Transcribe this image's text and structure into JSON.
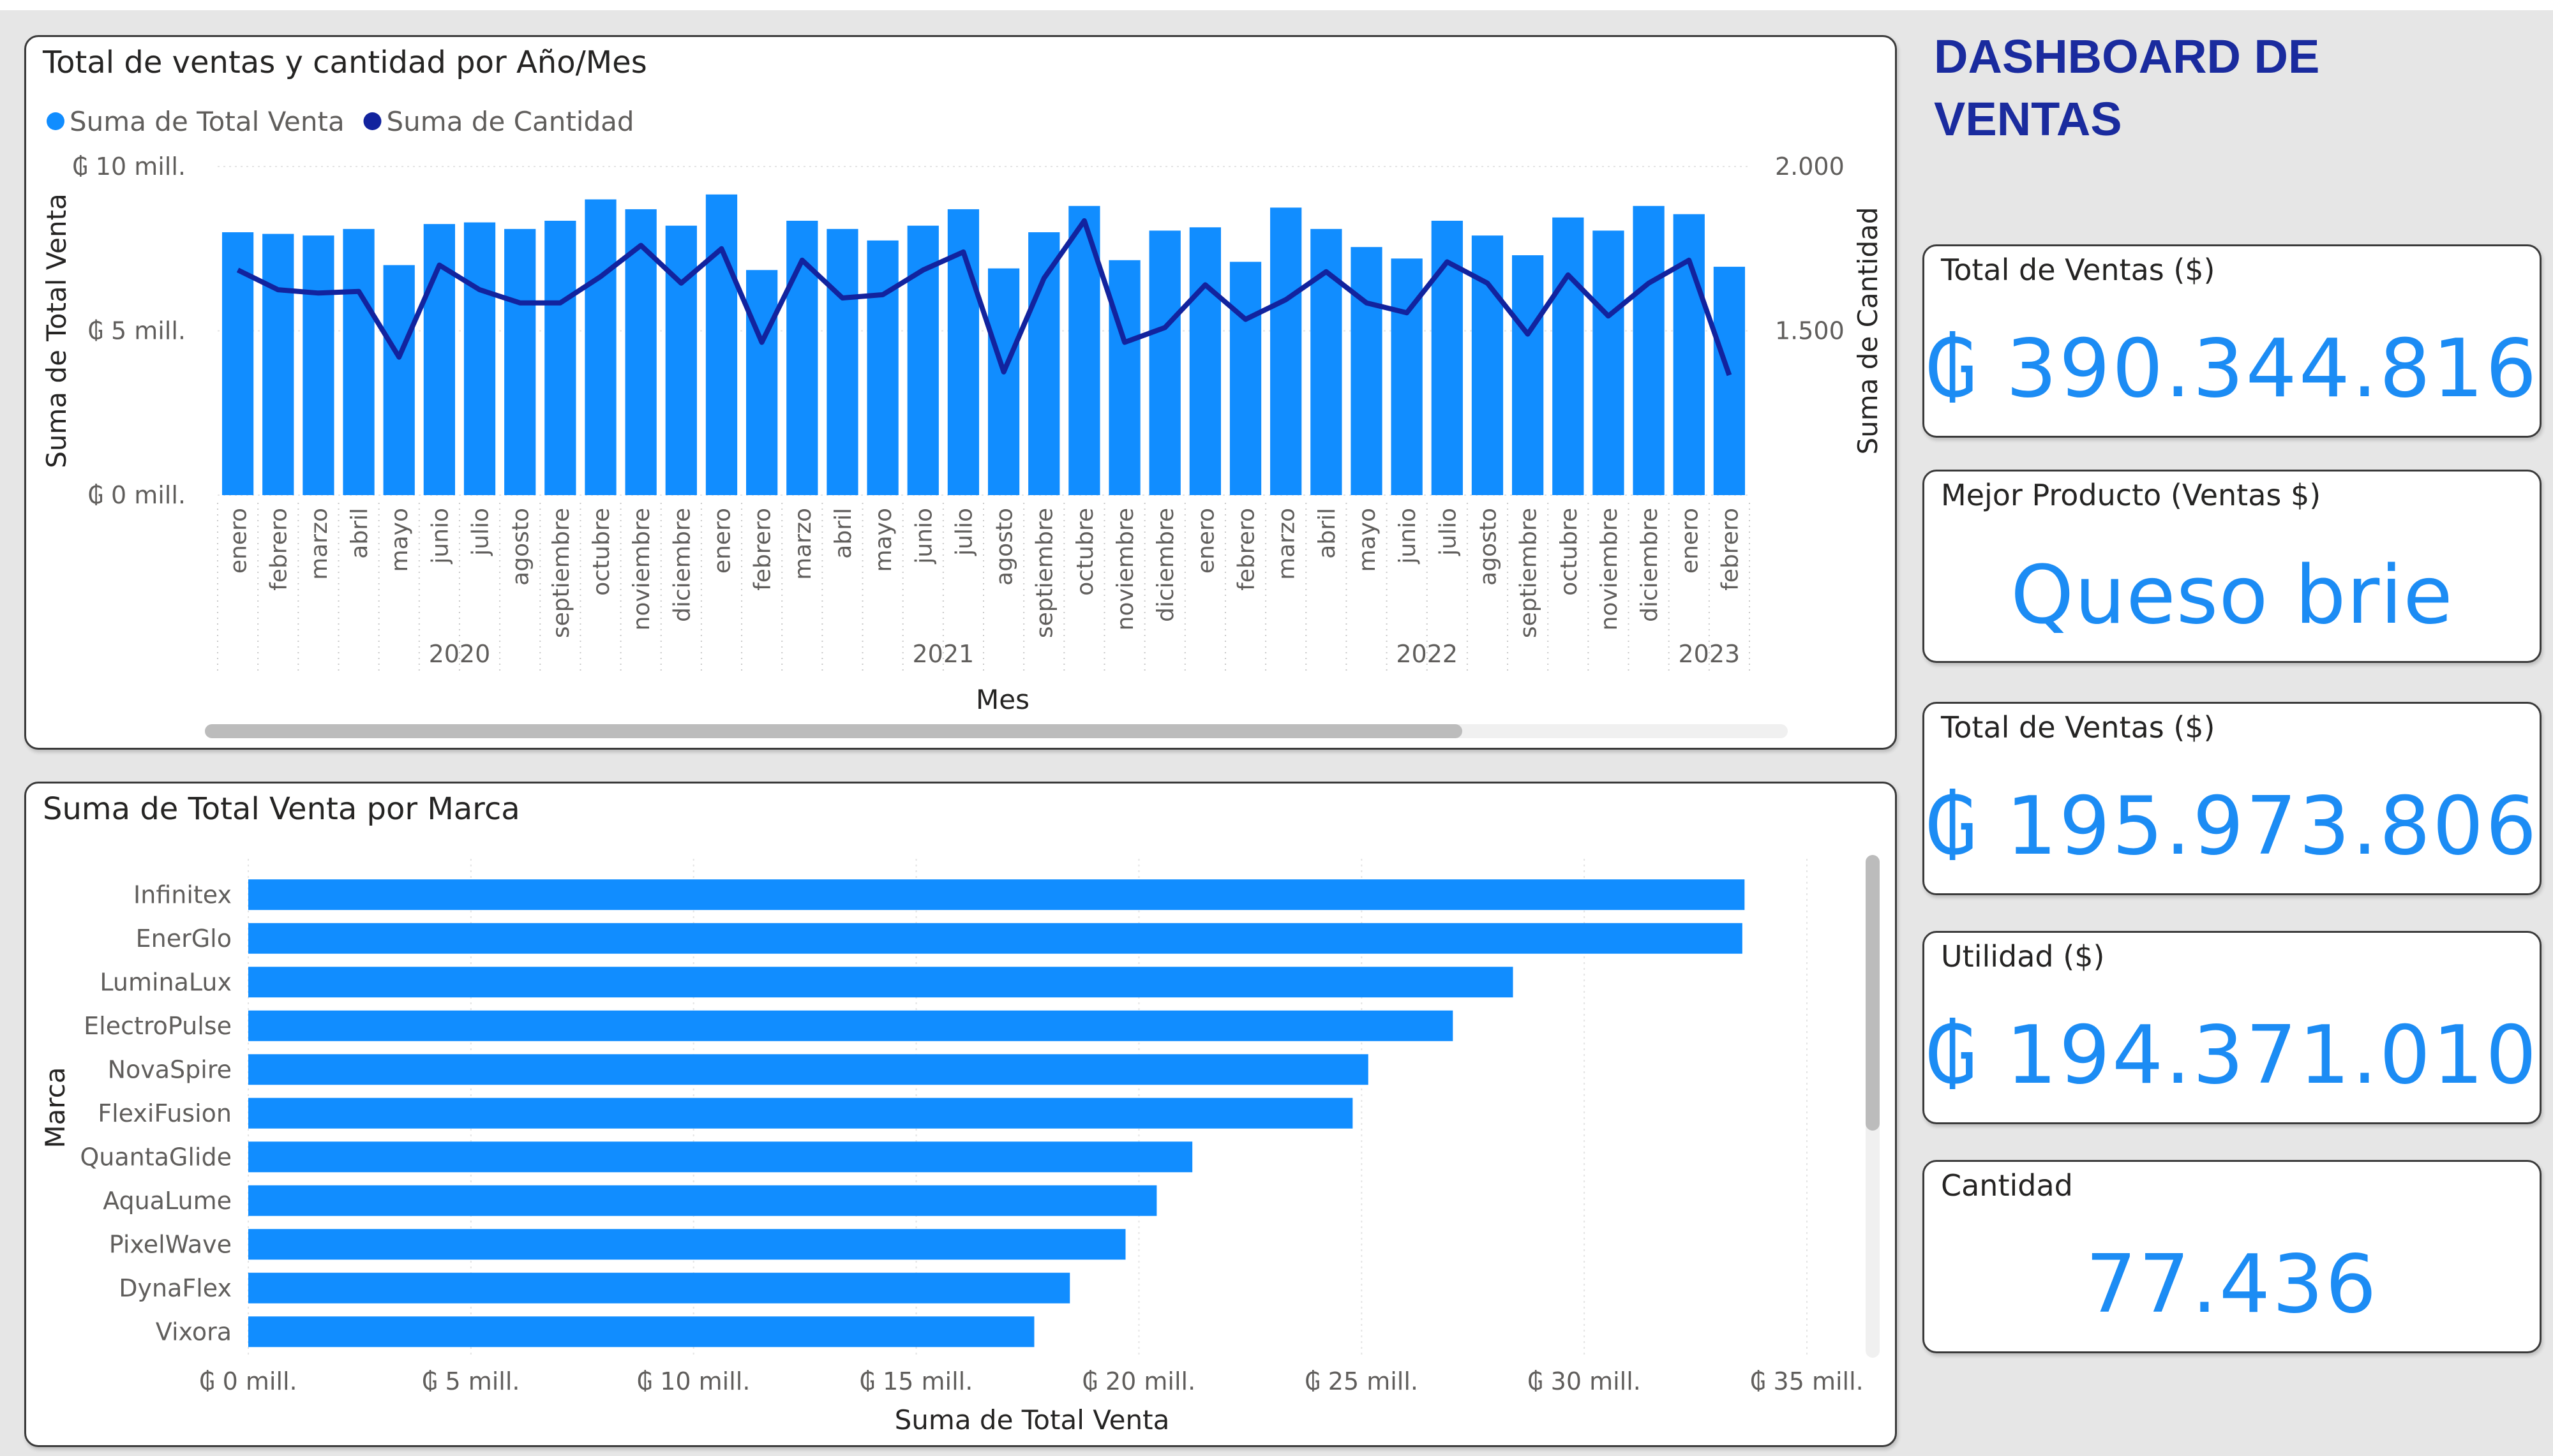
{
  "dashboard_title": "DASHBOARD DE VENTAS",
  "colors": {
    "bar": "#118dff",
    "line": "#12239e",
    "kpi_value": "#1c8cf4",
    "title": "#1a2b9e"
  },
  "chart_data": [
    {
      "type": "bar+line",
      "title": "Total de ventas y cantidad por Año/Mes",
      "legend": [
        "Suma de Total Venta",
        "Suma de Cantidad"
      ],
      "legend_position": "top-left",
      "xlabel": "Mes",
      "ylabel": "Suma de Total Venta",
      "y2label": "Suma de Cantidad",
      "ylim": [
        0,
        10
      ],
      "y_ticks": [
        "₲ 0 mill.",
        "₲ 5 mill.",
        "₲ 10 mill."
      ],
      "y2lim": [
        1000,
        2000
      ],
      "y2_ticks": [
        "1.500",
        "2.000"
      ],
      "years": [
        {
          "label": "2020",
          "count": 12
        },
        {
          "label": "2021",
          "count": 12
        },
        {
          "label": "2022",
          "count": 12
        },
        {
          "label": "2023",
          "count": 2
        }
      ],
      "months": [
        "enero",
        "febrero",
        "marzo",
        "abril",
        "mayo",
        "junio",
        "julio",
        "agosto",
        "septiembre",
        "octubre",
        "noviembre",
        "diciembre",
        "enero",
        "febrero",
        "marzo",
        "abril",
        "mayo",
        "junio",
        "julio",
        "agosto",
        "septiembre",
        "octubre",
        "noviembre",
        "diciembre",
        "enero",
        "febrero",
        "marzo",
        "abril",
        "mayo",
        "junio",
        "julio",
        "agosto",
        "septiembre",
        "octubre",
        "noviembre",
        "diciembre",
        "enero",
        "febrero"
      ],
      "series": [
        {
          "name": "Suma de Total Venta",
          "unit": "mill.",
          "values": [
            8.0,
            7.95,
            7.9,
            8.1,
            7.0,
            8.25,
            8.3,
            8.1,
            8.35,
            9.0,
            8.7,
            8.2,
            9.15,
            6.85,
            8.35,
            8.1,
            7.75,
            8.2,
            8.7,
            6.9,
            8.0,
            8.8,
            7.15,
            8.05,
            8.15,
            7.1,
            8.75,
            8.1,
            7.55,
            7.2,
            8.35,
            7.9,
            7.3,
            8.45,
            8.05,
            8.8,
            8.55,
            6.95
          ]
        },
        {
          "name": "Suma de Cantidad",
          "axis": "secondary",
          "values": [
            1685,
            1625,
            1615,
            1620,
            1420,
            1700,
            1625,
            1585,
            1585,
            1665,
            1760,
            1645,
            1750,
            1465,
            1715,
            1600,
            1610,
            1685,
            1740,
            1375,
            1660,
            1835,
            1465,
            1510,
            1640,
            1535,
            1595,
            1680,
            1585,
            1555,
            1710,
            1645,
            1490,
            1670,
            1545,
            1645,
            1715,
            1365
          ]
        }
      ]
    },
    {
      "type": "bar",
      "orientation": "horizontal",
      "title": "Suma de Total Venta por Marca",
      "xlabel": "Suma de Total Venta",
      "ylabel": "Marca",
      "xlim": [
        0,
        35
      ],
      "x_ticks": [
        "₲ 0 mill.",
        "₲ 5 mill.",
        "₲ 10 mill.",
        "₲ 15 mill.",
        "₲ 20 mill.",
        "₲ 25 mill.",
        "₲ 30 mill.",
        "₲ 35 mill."
      ],
      "categories": [
        "Infinitex",
        "EnerGlo",
        "LuminaLux",
        "ElectroPulse",
        "NovaSpire",
        "FlexiFusion",
        "QuantaGlide",
        "AquaLume",
        "PixelWave",
        "DynaFlex",
        "Vixora"
      ],
      "values": [
        33.6,
        33.55,
        28.4,
        27.05,
        25.15,
        24.8,
        21.2,
        20.4,
        19.7,
        18.45,
        17.65
      ]
    }
  ],
  "kpis": [
    {
      "label": "Total de Ventas ($)",
      "value": "₲ 390.344.816"
    },
    {
      "label": "Mejor Producto (Ventas $)",
      "value": "Queso brie"
    },
    {
      "label": "Total de Ventas ($)",
      "value": "₲ 195.973.806"
    },
    {
      "label": "Utilidad ($)",
      "value": "₲ 194.371.010"
    },
    {
      "label": "Cantidad",
      "value": "77.436"
    }
  ]
}
